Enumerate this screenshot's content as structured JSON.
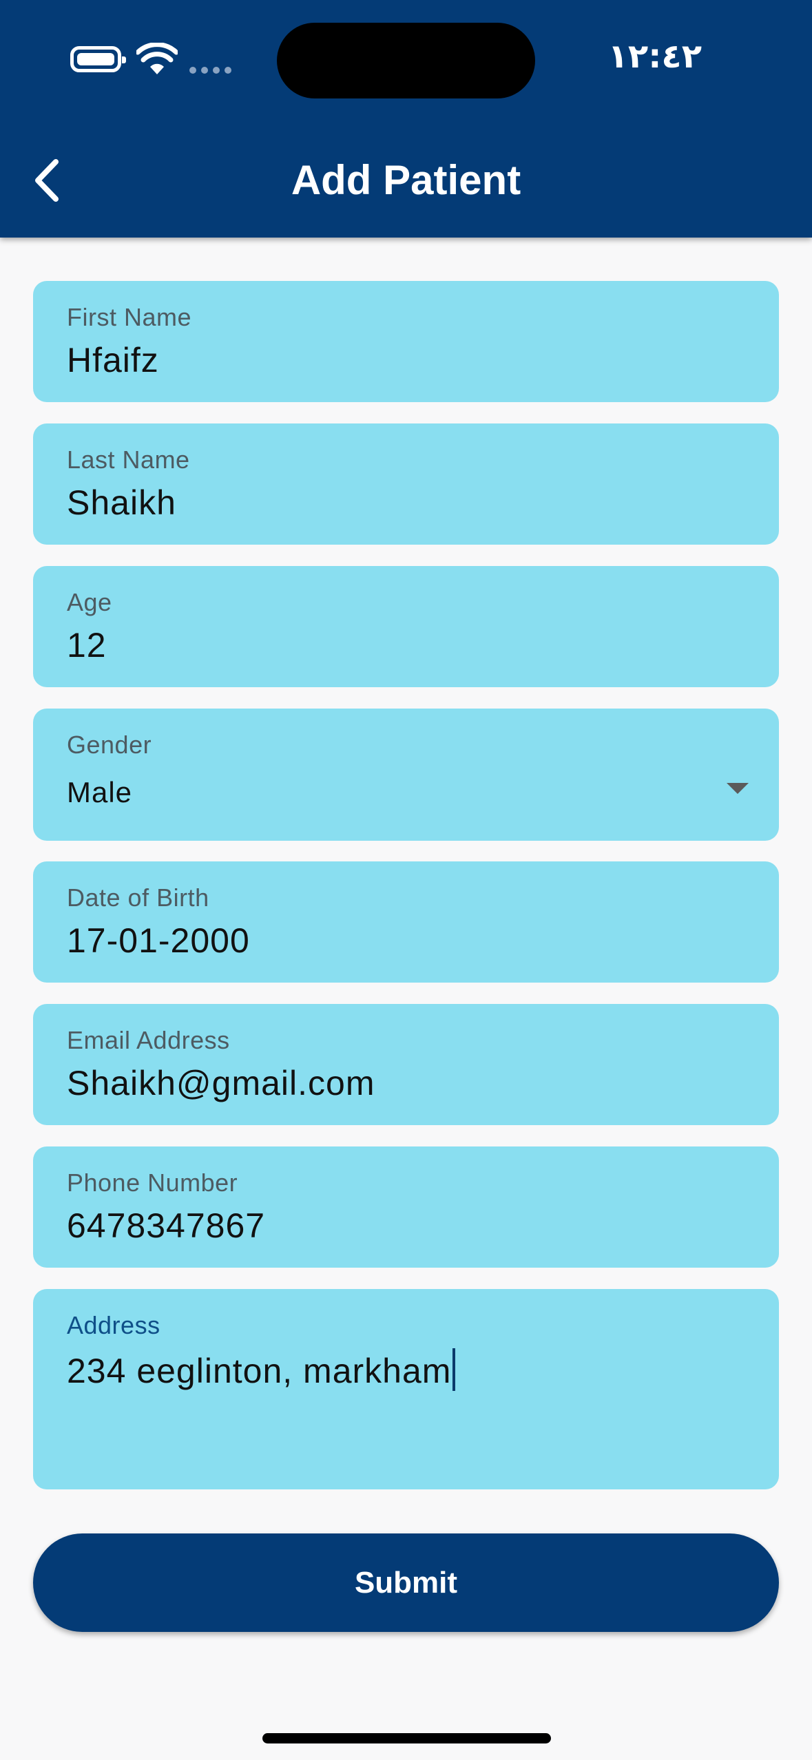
{
  "status_bar": {
    "time": "١٢:٤٢"
  },
  "header": {
    "title": "Add Patient",
    "back_icon": "chevron-left-icon"
  },
  "form": {
    "first_name": {
      "label": "First Name",
      "value": "Hfaifz"
    },
    "last_name": {
      "label": "Last Name",
      "value": "Shaikh"
    },
    "age": {
      "label": "Age",
      "value": "12"
    },
    "gender": {
      "label": "Gender",
      "value": "Male",
      "icon": "dropdown-arrow-icon"
    },
    "dob": {
      "label": "Date of Birth",
      "value": "17-01-2000"
    },
    "email": {
      "label": "Email Address",
      "value": "Shaikh@gmail.com"
    },
    "phone": {
      "label": "Phone Number",
      "value": "6478347867"
    },
    "address": {
      "label": "Address",
      "value": "234 eeglinton, markham"
    }
  },
  "submit_label": "Submit",
  "colors": {
    "header_bg": "#043b76",
    "field_bg": "#89def0",
    "page_bg": "#f8f8f9",
    "button_bg": "#043b76"
  }
}
